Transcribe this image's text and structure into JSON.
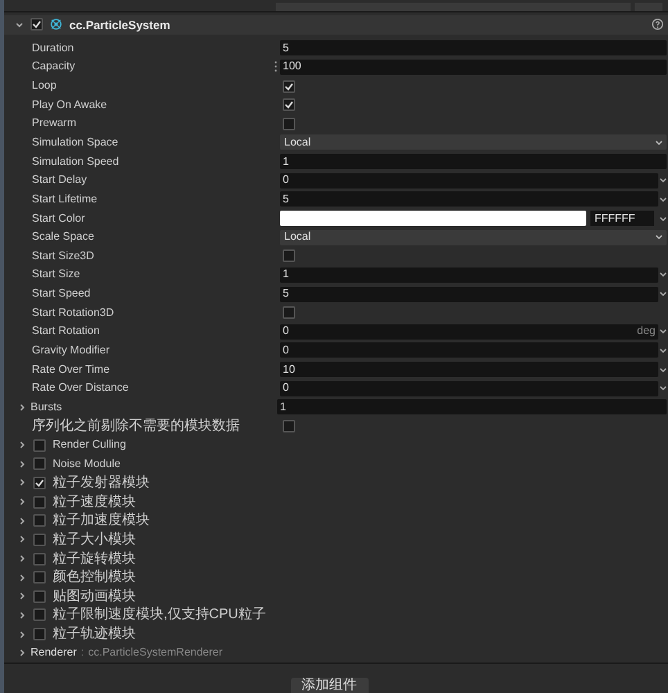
{
  "component": {
    "title": "cc.ParticleSystem",
    "enabled": true,
    "expanded": true
  },
  "properties": [
    {
      "label": "Duration",
      "kind": "number",
      "value": "5",
      "caret": false
    },
    {
      "label": "Capacity",
      "kind": "number",
      "value": "100",
      "caret": false,
      "handle": true
    },
    {
      "label": "Loop",
      "kind": "checkbox",
      "checked": true
    },
    {
      "label": "Play On Awake",
      "kind": "checkbox",
      "checked": true
    },
    {
      "label": "Prewarm",
      "kind": "checkbox",
      "checked": false
    },
    {
      "label": "Simulation Space",
      "kind": "select",
      "value": "Local"
    },
    {
      "label": "Simulation Speed",
      "kind": "number",
      "value": "1",
      "caret": false
    },
    {
      "label": "Start Delay",
      "kind": "number",
      "value": "0",
      "caret": true
    },
    {
      "label": "Start Lifetime",
      "kind": "number",
      "value": "5",
      "caret": true
    },
    {
      "label": "Start Color",
      "kind": "color",
      "color": "#ffffff",
      "value": "FFFFFF"
    },
    {
      "label": "Scale Space",
      "kind": "select",
      "value": "Local"
    },
    {
      "label": "Start Size3D",
      "kind": "checkbox",
      "checked": false
    },
    {
      "label": "Start Size",
      "kind": "number",
      "value": "1",
      "caret": true
    },
    {
      "label": "Start Speed",
      "kind": "number",
      "value": "5",
      "caret": true
    },
    {
      "label": "Start Rotation3D",
      "kind": "checkbox",
      "checked": false
    },
    {
      "label": "Start Rotation",
      "kind": "number",
      "value": "0",
      "caret": true,
      "unit": "deg"
    },
    {
      "label": "Gravity Modifier",
      "kind": "number",
      "value": "0",
      "caret": true
    },
    {
      "label": "Rate Over Time",
      "kind": "number",
      "value": "10",
      "caret": true
    },
    {
      "label": "Rate Over Distance",
      "kind": "number",
      "value": "0",
      "caret": true
    },
    {
      "label": "Bursts",
      "kind": "group",
      "value": "1",
      "expanded": false
    },
    {
      "label": "序列化之前剔除不需要的模块数据",
      "kind": "checkbox",
      "checked": false
    }
  ],
  "modules": [
    {
      "label": "Render Culling",
      "checked": false,
      "expanded": false
    },
    {
      "label": "Noise Module",
      "checked": false,
      "expanded": false
    },
    {
      "label": "粒子发射器模块",
      "checked": true,
      "expanded": false
    },
    {
      "label": "粒子速度模块",
      "checked": false,
      "expanded": false
    },
    {
      "label": "粒子加速度模块",
      "checked": false,
      "expanded": false
    },
    {
      "label": "粒子大小模块",
      "checked": false,
      "expanded": false
    },
    {
      "label": "粒子旋转模块",
      "checked": false,
      "expanded": false
    },
    {
      "label": "颜色控制模块",
      "checked": false,
      "expanded": false
    },
    {
      "label": "贴图动画模块",
      "checked": false,
      "expanded": false
    },
    {
      "label": "粒子限制速度模块,仅支持CPU粒子",
      "checked": false,
      "expanded": false
    },
    {
      "label": "粒子轨迹模块",
      "checked": false,
      "expanded": false
    }
  ],
  "renderer": {
    "label": "Renderer",
    "separator": ":",
    "type": "cc.ParticleSystemRenderer",
    "expanded": false
  },
  "add_button": "添加组件"
}
